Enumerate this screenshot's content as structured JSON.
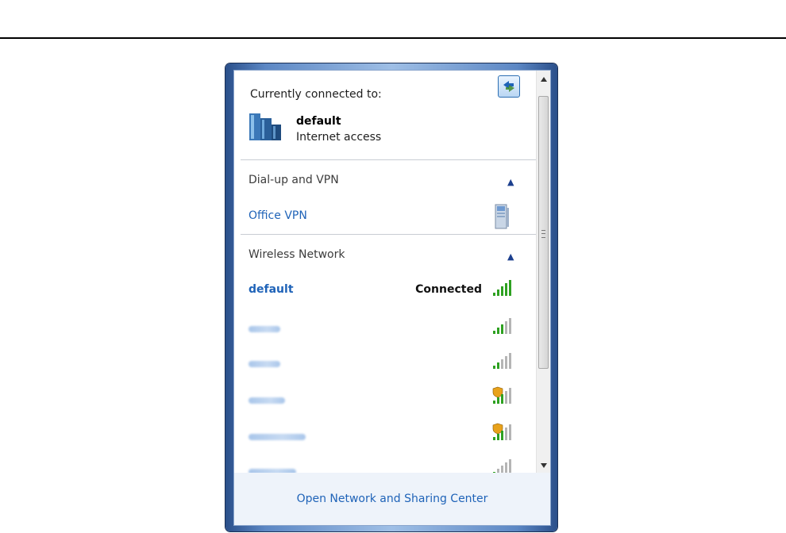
{
  "header": {
    "label": "Currently connected to:",
    "refresh_icon": "refresh-icon"
  },
  "current_connection": {
    "name": "default",
    "status": "Internet access",
    "icon": "network-building-icon"
  },
  "dialup_section": {
    "title": "Dial-up and VPN",
    "items": [
      {
        "label": "Office VPN",
        "icon": "vpn-icon"
      }
    ]
  },
  "wireless_section": {
    "title": "Wireless Network",
    "networks": [
      {
        "name": "default",
        "status": "Connected",
        "secured": false
      },
      {
        "name": "",
        "secured": false
      },
      {
        "name": "",
        "secured": false
      },
      {
        "name": "",
        "secured": true
      },
      {
        "name": "",
        "secured": true
      },
      {
        "name": "",
        "secured": false
      }
    ]
  },
  "footer": {
    "link": "Open Network and Sharing Center"
  },
  "colors": {
    "link": "#1f63b8",
    "signal_green": "#2ea121",
    "frame_blue": "#5c87c4"
  }
}
